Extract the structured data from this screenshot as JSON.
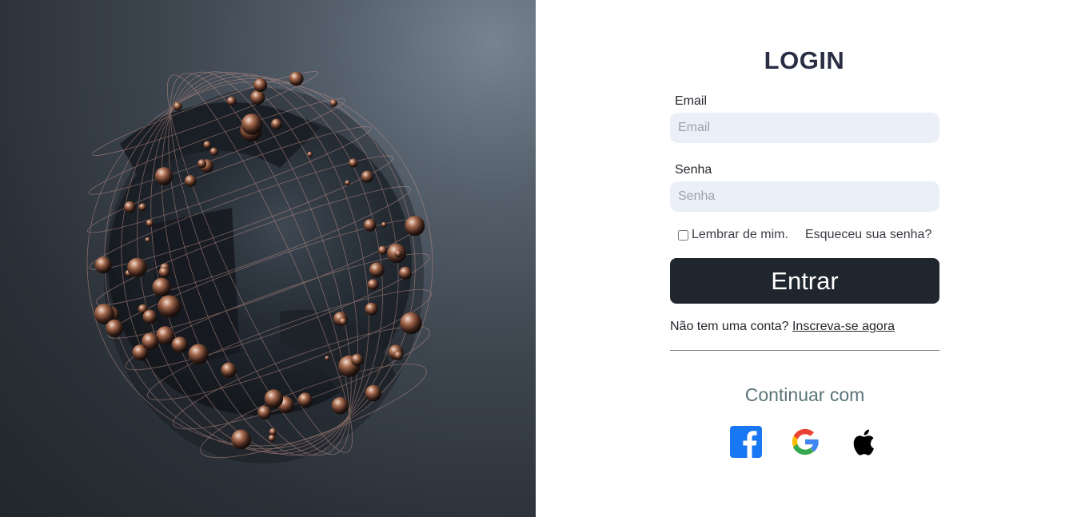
{
  "hero": {
    "image": "abstract-3d-sphere-illustration"
  },
  "login": {
    "title": "LOGIN",
    "email_label": "Email",
    "email_placeholder": "Email",
    "password_label": "Senha",
    "password_placeholder": "Senha",
    "remember_label": "Lembrar de mim.",
    "forgot_link": "Esqueceu sua senha?",
    "submit_label": "Entrar",
    "signup_prompt": "Não tem uma conta?",
    "signup_link": "Inscreva-se agora",
    "continue_with": "Continuar com",
    "social": [
      {
        "icon": "facebook-icon",
        "color": "#1877f2"
      },
      {
        "icon": "google-icon",
        "colors": [
          "#4285f4",
          "#34a853",
          "#fbbc05",
          "#ea4335"
        ]
      },
      {
        "icon": "apple-icon",
        "color": "#000000"
      }
    ]
  },
  "colors": {
    "title": "#2a2e45",
    "input_bg": "#ebeff7",
    "button_bg": "#20262e",
    "continue_text": "#5a7478"
  }
}
